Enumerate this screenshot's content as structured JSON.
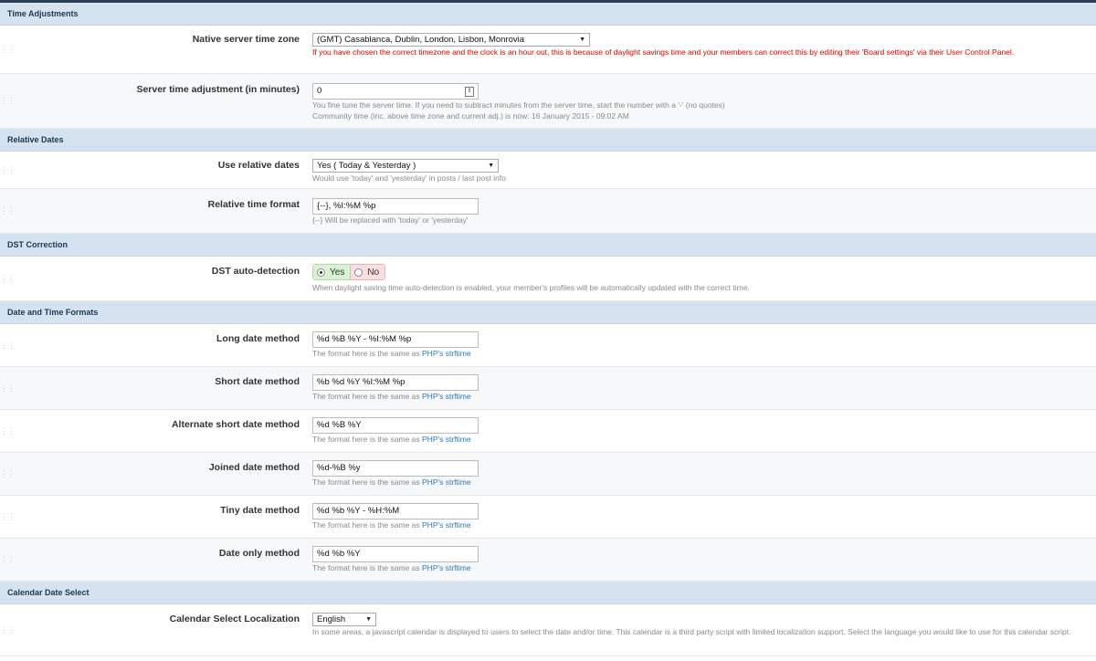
{
  "sections": {
    "time_adjustments": "Time Adjustments",
    "relative_dates": "Relative Dates",
    "dst_correction": "DST Correction",
    "date_time_formats": "Date and Time Formats",
    "calendar_date_select": "Calendar Date Select"
  },
  "timezone": {
    "label": "Native server time zone",
    "value": "(GMT) Casablanca, Dublin, London, Lisbon, Monrovia",
    "warning": "If you have chosen the correct timezone and the clock is an hour out, this is because of daylight savings time and your members can correct this by editing their 'Board settings' via their User Control Panel."
  },
  "server_adjust": {
    "label": "Server time adjustment (in minutes)",
    "value": "0",
    "desc1": "You fine tune the server time. If you need to subtract minutes from the server time, start the number with a '-' (no quotes)",
    "desc2": "Community time (inc. above time zone and current adj.) is now: 16 January 2015 - 09:02 AM"
  },
  "relative_dates": {
    "label": "Use relative dates",
    "value": "Yes ( Today & Yesterday )",
    "desc": "Would use 'today' and 'yesterday' in posts / last post info"
  },
  "relative_format": {
    "label": "Relative time format",
    "value": "{--}, %I:%M %p",
    "desc": "{--} Will be replaced with 'today' or 'yesterday'"
  },
  "dst": {
    "label": "DST auto-detection",
    "yes": "Yes",
    "no": "No",
    "desc": "When daylight saving time auto-detection is enabled, your member's profiles will be automatically updated with the correct time."
  },
  "format_desc": "The format here is the same as",
  "format_link": "PHP's strftime",
  "formats": [
    {
      "label": "Long date method",
      "value": "%d %B %Y - %I:%M %p"
    },
    {
      "label": "Short date method",
      "value": "%b %d %Y %I:%M %p"
    },
    {
      "label": "Alternate short date method",
      "value": "%d %B %Y"
    },
    {
      "label": "Joined date method",
      "value": "%d-%B %y"
    },
    {
      "label": "Tiny date method",
      "value": "%d %b %Y - %H:%M"
    },
    {
      "label": "Date only method",
      "value": "%d %b %Y"
    }
  ],
  "calendar": {
    "label": "Calendar Select Localization",
    "value": "English",
    "desc": "In some areas, a javascript calendar is displayed to users to select the date and/or time. This calendar is a third party script with limited localization support. Select the language you would like to use for this calendar script."
  }
}
